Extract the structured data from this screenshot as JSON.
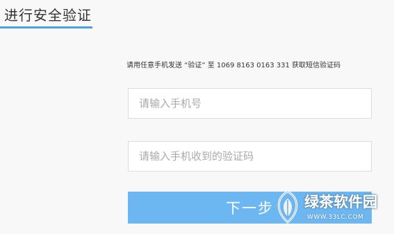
{
  "page": {
    "title": "进行安全验证",
    "accent_color": "#4c9fe0",
    "background_color": "#f8f8f8"
  },
  "instruction": "请用任意手机发送 “验证” 至 1069 8163 0163 331 获取短信验证码",
  "phone_input": {
    "placeholder": "请输入手机号",
    "value": ""
  },
  "code_input": {
    "placeholder": "请输入手机收到的验证码",
    "value": ""
  },
  "next_button": {
    "label": "下一步",
    "color": "#6cb7f2"
  },
  "watermark": {
    "logo_icon": "leaf-logo-icon",
    "name": "绿茶软件园",
    "url": "WWW.33LC.COM"
  }
}
